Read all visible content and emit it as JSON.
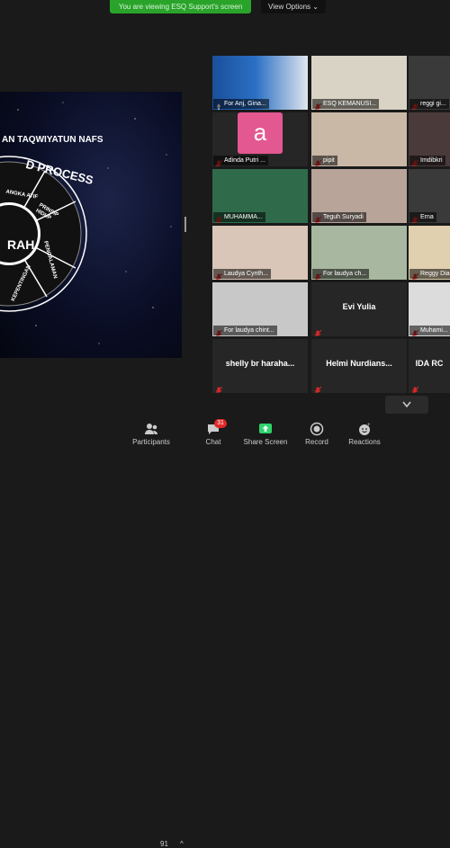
{
  "banner": {
    "text": "You are viewing ESQ Support's screen"
  },
  "view_options": {
    "label": "View Options ⌄"
  },
  "slide": {
    "title": "AN TAQWIYATUN NAFS",
    "process_text": "D PROCESS",
    "center_text": "RAH",
    "segments": [
      "ANGKA ATIF",
      "PRINSIP HIDUP",
      "PENGALAMAN",
      "KEPENTINGAN"
    ]
  },
  "tiles": [
    {
      "name": "For Anj, Gina...",
      "kind": "active"
    },
    {
      "name": "ESQ KEMANUSI...",
      "kind": "cam"
    },
    {
      "name": "reggi gi...",
      "kind": "cam"
    },
    {
      "name": "Adinda Putri ...",
      "kind": "avatar",
      "avatar": "a"
    },
    {
      "name": "pipit",
      "kind": "cam"
    },
    {
      "name": "Imdibkri",
      "kind": "cam"
    },
    {
      "name": "MUHAMMA...",
      "kind": "cam"
    },
    {
      "name": "Teguh Suryadi",
      "kind": "cam"
    },
    {
      "name": "Erna",
      "kind": "cam"
    },
    {
      "name": "Laudya Cynth...",
      "kind": "cam"
    },
    {
      "name": "For laudya ch...",
      "kind": "cam"
    },
    {
      "name": "Reggy Dian...",
      "kind": "cam"
    },
    {
      "name": "For laudya chint...",
      "kind": "cam"
    },
    {
      "name": "",
      "kind": "text",
      "big": "Evi Yulia"
    },
    {
      "name": "Muhami...",
      "kind": "cam"
    },
    {
      "name": "",
      "kind": "text",
      "big": "shelly br harahа..."
    },
    {
      "name": "",
      "kind": "text",
      "big": "Helmi  Nurdians..."
    },
    {
      "name": "",
      "kind": "text",
      "big": "IDA RC"
    }
  ],
  "toolbar": {
    "participants": {
      "label": "Participants",
      "count": "91"
    },
    "chat": {
      "label": "Chat",
      "badge": "31"
    },
    "share": {
      "label": "Share Screen"
    },
    "record": {
      "label": "Record"
    },
    "reactions": {
      "label": "Reactions"
    }
  },
  "colors": {
    "active_border": "#c8d62a",
    "share_green": "#2dd36b",
    "badge_red": "#e02828"
  }
}
